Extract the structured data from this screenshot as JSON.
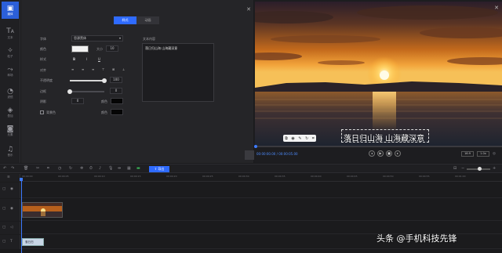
{
  "sidebar": {
    "items": [
      {
        "icon": "media-icon",
        "label": "媒体",
        "active": true
      },
      {
        "icon": "text-icon",
        "label": "文本",
        "active": false
      },
      {
        "icon": "particle-icon",
        "label": "粒子",
        "active": false
      },
      {
        "icon": "transition-icon",
        "label": "转场",
        "active": false
      },
      {
        "icon": "filter-icon",
        "label": "滤镜",
        "active": false
      },
      {
        "icon": "overlay-icon",
        "label": "叠加",
        "active": false
      },
      {
        "icon": "element-icon",
        "label": "元素",
        "active": false
      },
      {
        "icon": "music-icon",
        "label": "音乐",
        "active": false
      }
    ]
  },
  "editor": {
    "tabs": [
      {
        "label": "样式",
        "active": true
      },
      {
        "label": "动画",
        "active": false
      }
    ],
    "font_label": "字体",
    "font_value": "思源黑体",
    "color_label": "颜色",
    "size_label": "大小",
    "size_value": "10",
    "style_label": "样式",
    "style_buttons": [
      "B",
      "I",
      "U"
    ],
    "align_label": "对齐",
    "opacity_label": "不透明度",
    "opacity_value": "100",
    "opacity_level": 1.0,
    "border_label": "边框",
    "border_value": "0",
    "border_level": 0.0,
    "shadow_label": "阴影",
    "shadow_value": "0",
    "shadow_color_label": "颜色",
    "bg_label": "背景色",
    "bg_color_label": "颜色",
    "text_content_label": "文本内容",
    "text_content": "落日归山海 山海藏深意",
    "ok_label": "确定"
  },
  "preview": {
    "subtitle": "落日归山海 山海藏深意",
    "timecode": "00:00:00.00 / 00:00:05.00",
    "ratio": "16:9",
    "zoom": "1.0x"
  },
  "timeline": {
    "export_label": "导出",
    "ticks": [
      "00:00:00",
      "00:00:05",
      "00:00:10",
      "00:00:15",
      "00:00:20",
      "00:00:25",
      "00:00:30",
      "00:00:35",
      "00:00:40",
      "00:00:45",
      "00:00:50",
      "00:00:55",
      "00:01:00"
    ],
    "text_clip_label": "落日归"
  },
  "watermark": "头条 @手机科技先锋",
  "colors": {
    "accent": "#2f6bff",
    "background": "#1b1b1d",
    "panel": "#252528"
  }
}
